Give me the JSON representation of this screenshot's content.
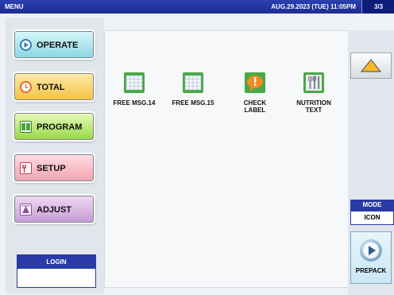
{
  "topbar": {
    "title": "MENU",
    "datetime": "AUG.29.2023 (TUE) 11:05PM",
    "page": "3/3"
  },
  "menu": {
    "operate": "OPERATE",
    "total": "TOTAL",
    "program": "PROGRAM",
    "setup": "SETUP",
    "adjust": "ADJUST"
  },
  "login": {
    "label": "LOGIN",
    "value": ""
  },
  "items": [
    {
      "label": "FREE MSG.14",
      "icon": "grid-sheet-icon"
    },
    {
      "label": "FREE MSG.15",
      "icon": "grid-sheet-icon"
    },
    {
      "label": "CHECK\nLABEL",
      "icon": "warning-label-icon"
    },
    {
      "label": "NUTRITION\nTEXT",
      "icon": "nutrition-icon"
    }
  ],
  "mode": {
    "label": "MODE",
    "value": "ICON"
  },
  "prepack": {
    "label": "PREPACK"
  },
  "colors": {
    "accent": "#2a3aa6",
    "topbar": "#1c2c92"
  }
}
